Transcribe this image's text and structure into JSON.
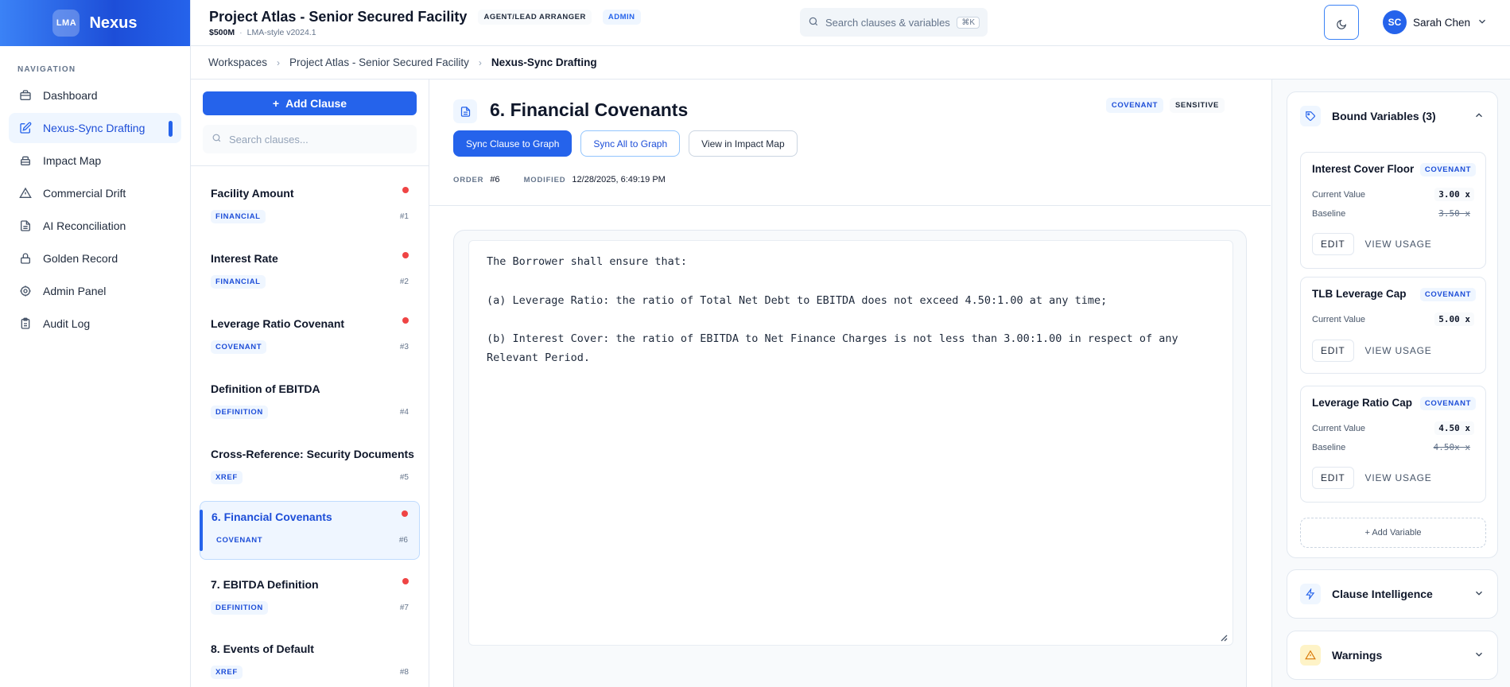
{
  "brand": {
    "logo_text": "LMA",
    "name": "Nexus"
  },
  "nav": {
    "title": "NAVIGATION",
    "items": [
      {
        "label": "Dashboard",
        "icon": "briefcase-icon"
      },
      {
        "label": "Nexus-Sync Drafting",
        "icon": "edit-icon",
        "active": true
      },
      {
        "label": "Impact Map",
        "icon": "layers-icon"
      },
      {
        "label": "Commercial Drift",
        "icon": "warning-icon"
      },
      {
        "label": "AI Reconciliation",
        "icon": "document-icon"
      },
      {
        "label": "Golden Record",
        "icon": "lock-icon"
      },
      {
        "label": "Admin Panel",
        "icon": "gear-icon"
      },
      {
        "label": "Audit Log",
        "icon": "clipboard-icon"
      }
    ]
  },
  "header": {
    "project_title": "Project Atlas - Senior Secured Facility",
    "role_badge": "AGENT/LEAD ARRANGER",
    "admin_badge": "ADMIN",
    "amount": "$500M",
    "style_version": "LMA-style v2024.1",
    "search_placeholder": "Search clauses & variables",
    "search_shortcut": "⌘K",
    "user_initials": "SC",
    "user_name": "Sarah Chen"
  },
  "breadcrumb": [
    "Workspaces",
    "Project Atlas - Senior Secured Facility",
    "Nexus-Sync Drafting"
  ],
  "clause_list": {
    "add_label": "Add Clause",
    "search_placeholder": "Search clauses...",
    "items": [
      {
        "name": "Facility Amount",
        "tag": "FINANCIAL",
        "num": "#1",
        "dot": true
      },
      {
        "name": "Interest Rate",
        "tag": "FINANCIAL",
        "num": "#2",
        "dot": true
      },
      {
        "name": "Leverage Ratio Covenant",
        "tag": "COVENANT",
        "num": "#3",
        "dot": true
      },
      {
        "name": "Definition of EBITDA",
        "tag": "DEFINITION",
        "num": "#4",
        "dot": false
      },
      {
        "name": "Cross-Reference: Security Documents",
        "tag": "XREF",
        "num": "#5",
        "dot": false
      },
      {
        "name": "6. Financial Covenants",
        "tag": "COVENANT",
        "num": "#6",
        "dot": true,
        "active": true
      },
      {
        "name": "7. EBITDA Definition",
        "tag": "DEFINITION",
        "num": "#7",
        "dot": true
      },
      {
        "name": "8. Events of Default",
        "tag": "XREF",
        "num": "#8",
        "dot": false
      }
    ]
  },
  "editor": {
    "title": "6. Financial Covenants",
    "badge_type": "COVENANT",
    "badge_sensitive": "SENSITIVE",
    "btn_sync_clause": "Sync Clause to Graph",
    "btn_sync_all": "Sync All to Graph",
    "btn_impact": "View in Impact Map",
    "order_label": "ORDER",
    "order_value": "#6",
    "modified_label": "MODIFIED",
    "modified_value": "12/28/2025, 6:49:19 PM",
    "body_lines": [
      "The Borrower shall ensure that:",
      "",
      "(a) Leverage Ratio: the ratio of Total Net Debt to EBITDA does not exceed 4.50:1.00 at any time;",
      "",
      "(b) Interest Cover: the ratio of EBITDA to Net Finance Charges is not less than 3.00:1.00 in respect of any",
      "Relevant Period."
    ]
  },
  "right_panel": {
    "bound_title": "Bound Variables (3)",
    "variables": [
      {
        "name": "Interest Cover Floor",
        "tag": "COVENANT",
        "current_label": "Current Value",
        "current": "3.00 x",
        "baseline_label": "Baseline",
        "baseline": "3.50 x"
      },
      {
        "name": "TLB Leverage Cap",
        "tag": "COVENANT",
        "current_label": "Current Value",
        "current": "5.00 x"
      },
      {
        "name": "Leverage Ratio Cap",
        "tag": "COVENANT",
        "current_label": "Current Value",
        "current": "4.50 x",
        "baseline_label": "Baseline",
        "baseline": "4.50x x"
      }
    ],
    "edit_label": "EDIT",
    "usage_label": "VIEW USAGE",
    "add_variable": "+ Add Variable",
    "intelligence_title": "Clause Intelligence",
    "warnings_title": "Warnings",
    "colors": {
      "accent": "#2563eb",
      "warning": "#f59e0b",
      "dot": "#ef4444"
    }
  }
}
